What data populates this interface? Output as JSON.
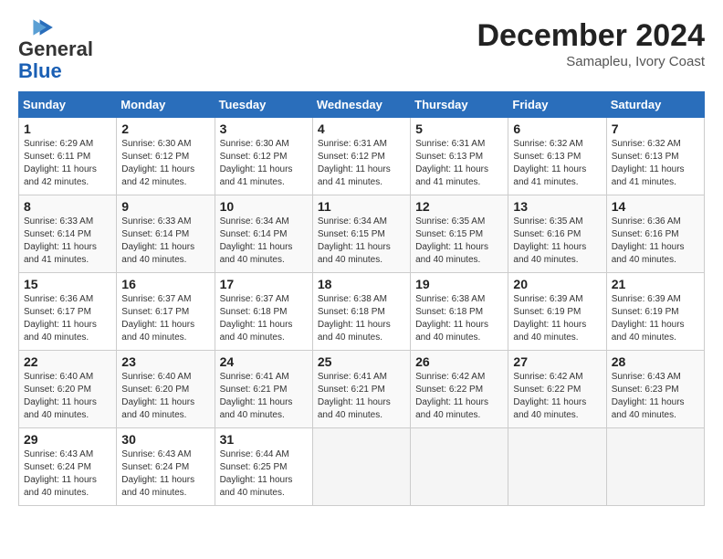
{
  "header": {
    "logo_line1": "General",
    "logo_line2": "Blue",
    "month": "December 2024",
    "location": "Samapleu, Ivory Coast"
  },
  "days_of_week": [
    "Sunday",
    "Monday",
    "Tuesday",
    "Wednesday",
    "Thursday",
    "Friday",
    "Saturday"
  ],
  "weeks": [
    [
      {
        "num": "1",
        "rise": "6:29 AM",
        "set": "6:11 PM",
        "daylight": "11 hours and 42 minutes."
      },
      {
        "num": "2",
        "rise": "6:30 AM",
        "set": "6:12 PM",
        "daylight": "11 hours and 42 minutes."
      },
      {
        "num": "3",
        "rise": "6:30 AM",
        "set": "6:12 PM",
        "daylight": "11 hours and 41 minutes."
      },
      {
        "num": "4",
        "rise": "6:31 AM",
        "set": "6:12 PM",
        "daylight": "11 hours and 41 minutes."
      },
      {
        "num": "5",
        "rise": "6:31 AM",
        "set": "6:13 PM",
        "daylight": "11 hours and 41 minutes."
      },
      {
        "num": "6",
        "rise": "6:32 AM",
        "set": "6:13 PM",
        "daylight": "11 hours and 41 minutes."
      },
      {
        "num": "7",
        "rise": "6:32 AM",
        "set": "6:13 PM",
        "daylight": "11 hours and 41 minutes."
      }
    ],
    [
      {
        "num": "8",
        "rise": "6:33 AM",
        "set": "6:14 PM",
        "daylight": "11 hours and 41 minutes."
      },
      {
        "num": "9",
        "rise": "6:33 AM",
        "set": "6:14 PM",
        "daylight": "11 hours and 40 minutes."
      },
      {
        "num": "10",
        "rise": "6:34 AM",
        "set": "6:14 PM",
        "daylight": "11 hours and 40 minutes."
      },
      {
        "num": "11",
        "rise": "6:34 AM",
        "set": "6:15 PM",
        "daylight": "11 hours and 40 minutes."
      },
      {
        "num": "12",
        "rise": "6:35 AM",
        "set": "6:15 PM",
        "daylight": "11 hours and 40 minutes."
      },
      {
        "num": "13",
        "rise": "6:35 AM",
        "set": "6:16 PM",
        "daylight": "11 hours and 40 minutes."
      },
      {
        "num": "14",
        "rise": "6:36 AM",
        "set": "6:16 PM",
        "daylight": "11 hours and 40 minutes."
      }
    ],
    [
      {
        "num": "15",
        "rise": "6:36 AM",
        "set": "6:17 PM",
        "daylight": "11 hours and 40 minutes."
      },
      {
        "num": "16",
        "rise": "6:37 AM",
        "set": "6:17 PM",
        "daylight": "11 hours and 40 minutes."
      },
      {
        "num": "17",
        "rise": "6:37 AM",
        "set": "6:18 PM",
        "daylight": "11 hours and 40 minutes."
      },
      {
        "num": "18",
        "rise": "6:38 AM",
        "set": "6:18 PM",
        "daylight": "11 hours and 40 minutes."
      },
      {
        "num": "19",
        "rise": "6:38 AM",
        "set": "6:18 PM",
        "daylight": "11 hours and 40 minutes."
      },
      {
        "num": "20",
        "rise": "6:39 AM",
        "set": "6:19 PM",
        "daylight": "11 hours and 40 minutes."
      },
      {
        "num": "21",
        "rise": "6:39 AM",
        "set": "6:19 PM",
        "daylight": "11 hours and 40 minutes."
      }
    ],
    [
      {
        "num": "22",
        "rise": "6:40 AM",
        "set": "6:20 PM",
        "daylight": "11 hours and 40 minutes."
      },
      {
        "num": "23",
        "rise": "6:40 AM",
        "set": "6:20 PM",
        "daylight": "11 hours and 40 minutes."
      },
      {
        "num": "24",
        "rise": "6:41 AM",
        "set": "6:21 PM",
        "daylight": "11 hours and 40 minutes."
      },
      {
        "num": "25",
        "rise": "6:41 AM",
        "set": "6:21 PM",
        "daylight": "11 hours and 40 minutes."
      },
      {
        "num": "26",
        "rise": "6:42 AM",
        "set": "6:22 PM",
        "daylight": "11 hours and 40 minutes."
      },
      {
        "num": "27",
        "rise": "6:42 AM",
        "set": "6:22 PM",
        "daylight": "11 hours and 40 minutes."
      },
      {
        "num": "28",
        "rise": "6:43 AM",
        "set": "6:23 PM",
        "daylight": "11 hours and 40 minutes."
      }
    ],
    [
      {
        "num": "29",
        "rise": "6:43 AM",
        "set": "6:24 PM",
        "daylight": "11 hours and 40 minutes."
      },
      {
        "num": "30",
        "rise": "6:43 AM",
        "set": "6:24 PM",
        "daylight": "11 hours and 40 minutes."
      },
      {
        "num": "31",
        "rise": "6:44 AM",
        "set": "6:25 PM",
        "daylight": "11 hours and 40 minutes."
      },
      null,
      null,
      null,
      null
    ]
  ]
}
